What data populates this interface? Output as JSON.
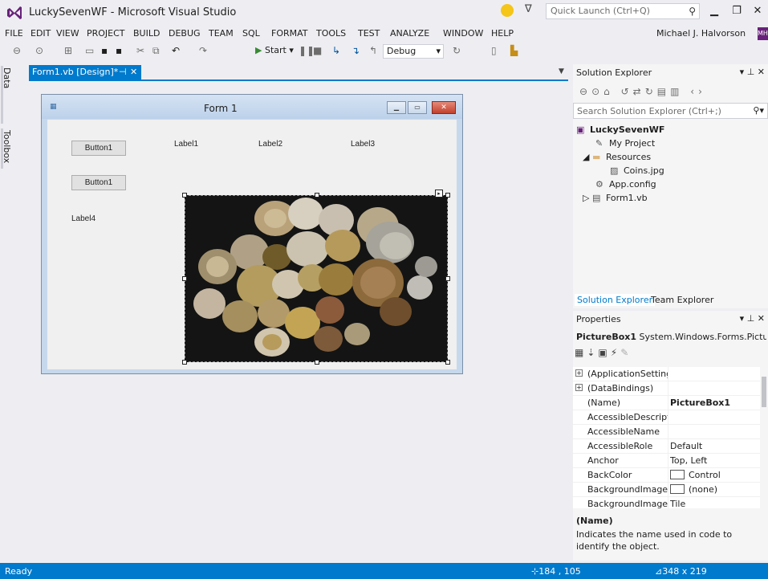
{
  "window": {
    "title": "LuckySevenWF - Microsoft Visual Studio",
    "quick_launch_placeholder": "Quick Launch (Ctrl+Q)",
    "min_glyph": "▁",
    "max_glyph": "❐",
    "close_glyph": "✕"
  },
  "menu": {
    "items": [
      "FILE",
      "EDIT",
      "VIEW",
      "PROJECT",
      "BUILD",
      "DEBUG",
      "TEAM",
      "SQL",
      "FORMAT",
      "TOOLS",
      "TEST",
      "ANALYZE",
      "WINDOW",
      "HELP"
    ],
    "user_name": "Michael J. Halvorson",
    "user_badge": "MH"
  },
  "toolbar": {
    "start_label": "Start",
    "configuration": "Debug"
  },
  "left_rail": {
    "tabs": [
      "Data Sources",
      "Toolbox"
    ]
  },
  "document_tab": {
    "label": "Form1.vb [Design]*",
    "pin_glyph": "⊣",
    "close_glyph": "✕"
  },
  "form": {
    "title": "Form 1",
    "button1_text": "Button1",
    "button2_text": "Button1",
    "label1": "Label1",
    "label2": "Label2",
    "label3": "Label3",
    "label4": "Label4"
  },
  "solution_explorer": {
    "title": "Solution Explorer",
    "search_placeholder": "Search Solution Explorer (Ctrl+;)",
    "tree": [
      {
        "label": "LuckySevenWF",
        "icon": "vb-project-icon"
      },
      {
        "label": "My Project",
        "icon": "wrench-icon"
      },
      {
        "label": "Resources",
        "icon": "folder-icon"
      },
      {
        "label": "Coins.jpg",
        "icon": "image-icon"
      },
      {
        "label": "App.config",
        "icon": "config-icon"
      },
      {
        "label": "Form1.vb",
        "icon": "form-icon"
      }
    ],
    "tabs": [
      "Solution Explorer",
      "Team Explorer"
    ]
  },
  "properties": {
    "title": "Properties",
    "object_name": "PictureBox1",
    "object_type": "System.Windows.Forms.Picture",
    "rows": [
      {
        "name": "(ApplicationSettings",
        "value": "",
        "category": true
      },
      {
        "name": "(DataBindings)",
        "value": "",
        "category": true
      },
      {
        "name": "(Name)",
        "value": "PictureBox1",
        "bold": true
      },
      {
        "name": "AccessibleDescriptic",
        "value": ""
      },
      {
        "name": "AccessibleName",
        "value": ""
      },
      {
        "name": "AccessibleRole",
        "value": "Default"
      },
      {
        "name": "Anchor",
        "value": "Top, Left"
      },
      {
        "name": "BackColor",
        "value": "Control",
        "swatch": true
      },
      {
        "name": "BackgroundImage",
        "value": "(none)",
        "swatch": true
      },
      {
        "name": "BackgroundImageLa",
        "value": "Tile"
      }
    ],
    "description_title": "(Name)",
    "description_text": "Indicates the name used in code to identify the object."
  },
  "status_bar": {
    "text": "Ready",
    "position": "184 , 105",
    "size": "348 x 219"
  },
  "colors": {
    "accent": "#007acc",
    "status_bar": "#007acc",
    "form_close": "#c2402b"
  }
}
